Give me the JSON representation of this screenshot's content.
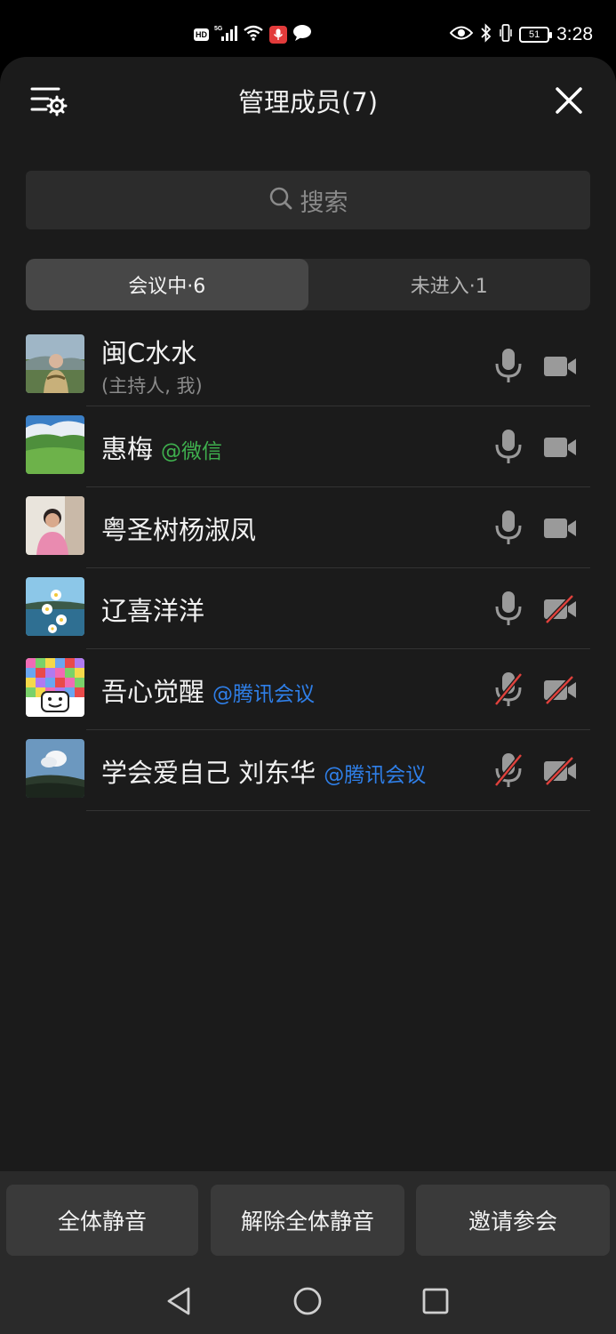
{
  "status_bar": {
    "hd": "HD",
    "net": "5G",
    "battery_level": "51",
    "time": "3:28"
  },
  "header": {
    "title": "管理成员(7)"
  },
  "search": {
    "placeholder": "搜索"
  },
  "tabs": [
    {
      "label": "会议中·6",
      "active": true
    },
    {
      "label": "未进入·1",
      "active": false
    }
  ],
  "members": [
    {
      "name": "闽C水水",
      "subtitle": "(主持人, 我)",
      "tag": "",
      "mic": "on",
      "camera": "on"
    },
    {
      "name": "惠梅",
      "tag": "@微信",
      "mic": "on",
      "camera": "on"
    },
    {
      "name": "粤圣树杨淑凤",
      "tag": "",
      "mic": "on",
      "camera": "on"
    },
    {
      "name": "辽喜洋洋",
      "tag": "",
      "mic": "on",
      "camera": "off"
    },
    {
      "name": "吾心觉醒",
      "tag": "@腾讯会议",
      "mic": "off",
      "camera": "off"
    },
    {
      "name": "学会爱自己 刘东华",
      "tag": "@腾讯会议",
      "mic": "off",
      "camera": "off"
    }
  ],
  "bottom_actions": {
    "mute_all": "全体静音",
    "unmute_all": "解除全体静音",
    "invite": "邀请参会"
  },
  "colors": {
    "background": "#1b1b1b",
    "tag_wechat": "#3fb04e",
    "tag_tencent": "#2f7fe8",
    "muted_slash": "#e0413c"
  }
}
